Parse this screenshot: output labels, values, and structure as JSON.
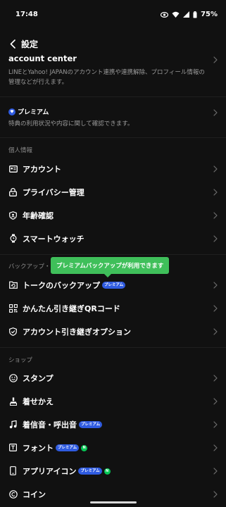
{
  "status": {
    "time": "17:48",
    "battery": "75%"
  },
  "header": {
    "title": "設定"
  },
  "account_center": {
    "title": "account center",
    "desc": "LINEとYahoo! JAPANのアカウント連携や連携解除、プロフィール情報の管理などが行えます。"
  },
  "premium": {
    "title": "プレミアム",
    "desc": "特典の利用状況や内容に関して確認できます。"
  },
  "sections": {
    "personal": "個人情報",
    "backup": "バックアップ・引き継ぎ",
    "shop": "ショップ"
  },
  "badge_label": "プレミアム",
  "new_label": "N",
  "tooltip": "プレミアムバックアップが利用できます",
  "personal_items": [
    {
      "label": "アカウント",
      "icon": "id-card-icon"
    },
    {
      "label": "プライバシー管理",
      "icon": "lock-icon"
    },
    {
      "label": "年齢確認",
      "icon": "shield-person-icon"
    },
    {
      "label": "スマートウォッチ",
      "icon": "watch-icon"
    }
  ],
  "backup_items": [
    {
      "label": "トークのバックアップ",
      "icon": "backup-folder-icon",
      "badge": true
    },
    {
      "label": "かんたん引き継ぎQRコード",
      "icon": "qr-code-icon"
    },
    {
      "label": "アカウント引き継ぎオプション",
      "icon": "shield-check-icon"
    }
  ],
  "shop_items": [
    {
      "label": "スタンプ",
      "icon": "sticker-smile-icon"
    },
    {
      "label": "着せかえ",
      "icon": "theme-brush-icon"
    },
    {
      "label": "着信音・呼出音",
      "icon": "music-note-icon",
      "badge": true
    },
    {
      "label": "フォント",
      "icon": "font-icon",
      "badge": true,
      "new": true
    },
    {
      "label": "アプリアイコン",
      "icon": "phone-icon",
      "badge": true,
      "new": true
    },
    {
      "label": "コイン",
      "icon": "coin-icon"
    }
  ]
}
